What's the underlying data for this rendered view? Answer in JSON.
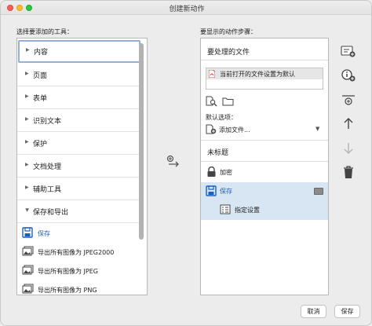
{
  "window": {
    "title": "创建新动作"
  },
  "left": {
    "section_label": "选择要添加的工具：",
    "categories": [
      {
        "label": "内容"
      },
      {
        "label": "页面"
      },
      {
        "label": "表单"
      },
      {
        "label": "识别文本"
      },
      {
        "label": "保护"
      },
      {
        "label": "文档处理"
      },
      {
        "label": "辅助工具"
      },
      {
        "label": "保存和导出"
      }
    ],
    "tools": [
      {
        "label": "保存"
      },
      {
        "label": "导出所有图像为 JPEG2000"
      },
      {
        "label": "导出所有图像为 JPEG"
      },
      {
        "label": "导出所有图像为 PNG"
      }
    ]
  },
  "right": {
    "section_label": "要显示的动作步骤：",
    "files_heading": "要处理的文件",
    "file_item": "当前打开的文件设置为默认",
    "default_options_label": "默认选项：",
    "add_file_label": "添加文件...",
    "untitled": "未标题",
    "encrypt": "加密",
    "save": "保存",
    "specify_settings": "指定设置"
  },
  "buttons": {
    "cancel": "取消",
    "save": "保存"
  },
  "colors": {
    "accent": "#1a5fbf",
    "selection": "#d8e6f3",
    "focus_ring": "#8fb1dc"
  },
  "icons": [
    "add-to-steps-icon",
    "search-file-icon",
    "folder-icon",
    "lock-icon",
    "save-disk-icon",
    "settings-list-icon",
    "pdf-file-icon",
    "insert-stop-icon",
    "insert-instruction-icon",
    "insert-separator-icon",
    "move-up-icon",
    "move-down-icon",
    "trash-icon"
  ]
}
